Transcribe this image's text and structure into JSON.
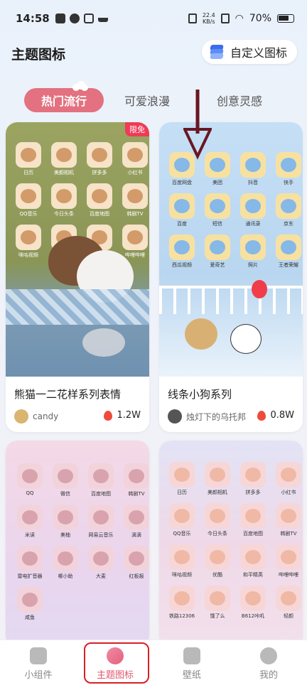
{
  "status_bar": {
    "time": "14:58",
    "net_speed_value": "22.4",
    "net_speed_unit": "KB/s",
    "battery": "70%"
  },
  "header": {
    "title": "主题图标",
    "custom_button_label": "自定义图标"
  },
  "tabs": [
    {
      "label": "热门流行",
      "active": true
    },
    {
      "label": "可爱浪漫",
      "active": false
    },
    {
      "label": "创意灵感",
      "active": false
    }
  ],
  "cards": [
    {
      "title": "熊猫一二花样系列表情",
      "author": "candy",
      "likes": "1.2W",
      "badge": "限免",
      "apps": [
        "日历",
        "美颜相机",
        "拼多多",
        "小红书",
        "QQ音乐",
        "今日头条",
        "百度地图",
        "韩剧TV",
        "咪咕视频",
        "优酷",
        "和平精英",
        "哔哩哔哩"
      ]
    },
    {
      "title": "线条小狗系列",
      "author": "烛灯下的乌托邦",
      "likes": "0.8W",
      "apps": [
        "百度网盘",
        "美团",
        "抖音",
        "快手",
        "百度",
        "短信",
        "通讯录",
        "京东",
        "西瓜视频",
        "爱奇艺",
        "照片",
        "王者荣耀"
      ]
    },
    {
      "apps": [
        "QQ",
        "微信",
        "百度地图",
        "韩剧TV",
        "米读",
        "美柚",
        "网易云音乐",
        "滴滴",
        "雷电扩音器",
        "哪小助",
        "大麦",
        "红板报",
        "咸鱼"
      ]
    },
    {
      "apps": [
        "日历",
        "美颜相机",
        "拼多多",
        "小红书",
        "QQ音乐",
        "今日头条",
        "百度地图",
        "韩剧TV",
        "咪咕视频",
        "优酷",
        "和平精英",
        "哔哩哔哩",
        "铁路12306",
        "饿了么",
        "B612咔叽",
        "轻颜"
      ]
    }
  ],
  "bottom_nav": [
    {
      "label": "小组件",
      "active": false
    },
    {
      "label": "主题图标",
      "active": true
    },
    {
      "label": "壁纸",
      "active": false
    },
    {
      "label": "我的",
      "active": false
    }
  ],
  "colors": {
    "accent": "#e3717f",
    "card1_bg": "#8f9a5a",
    "card2_bg": "#bcd8f2",
    "badge": "#ef3b57",
    "highlight_box": "#d81f26",
    "arrow": "#6a1622"
  }
}
